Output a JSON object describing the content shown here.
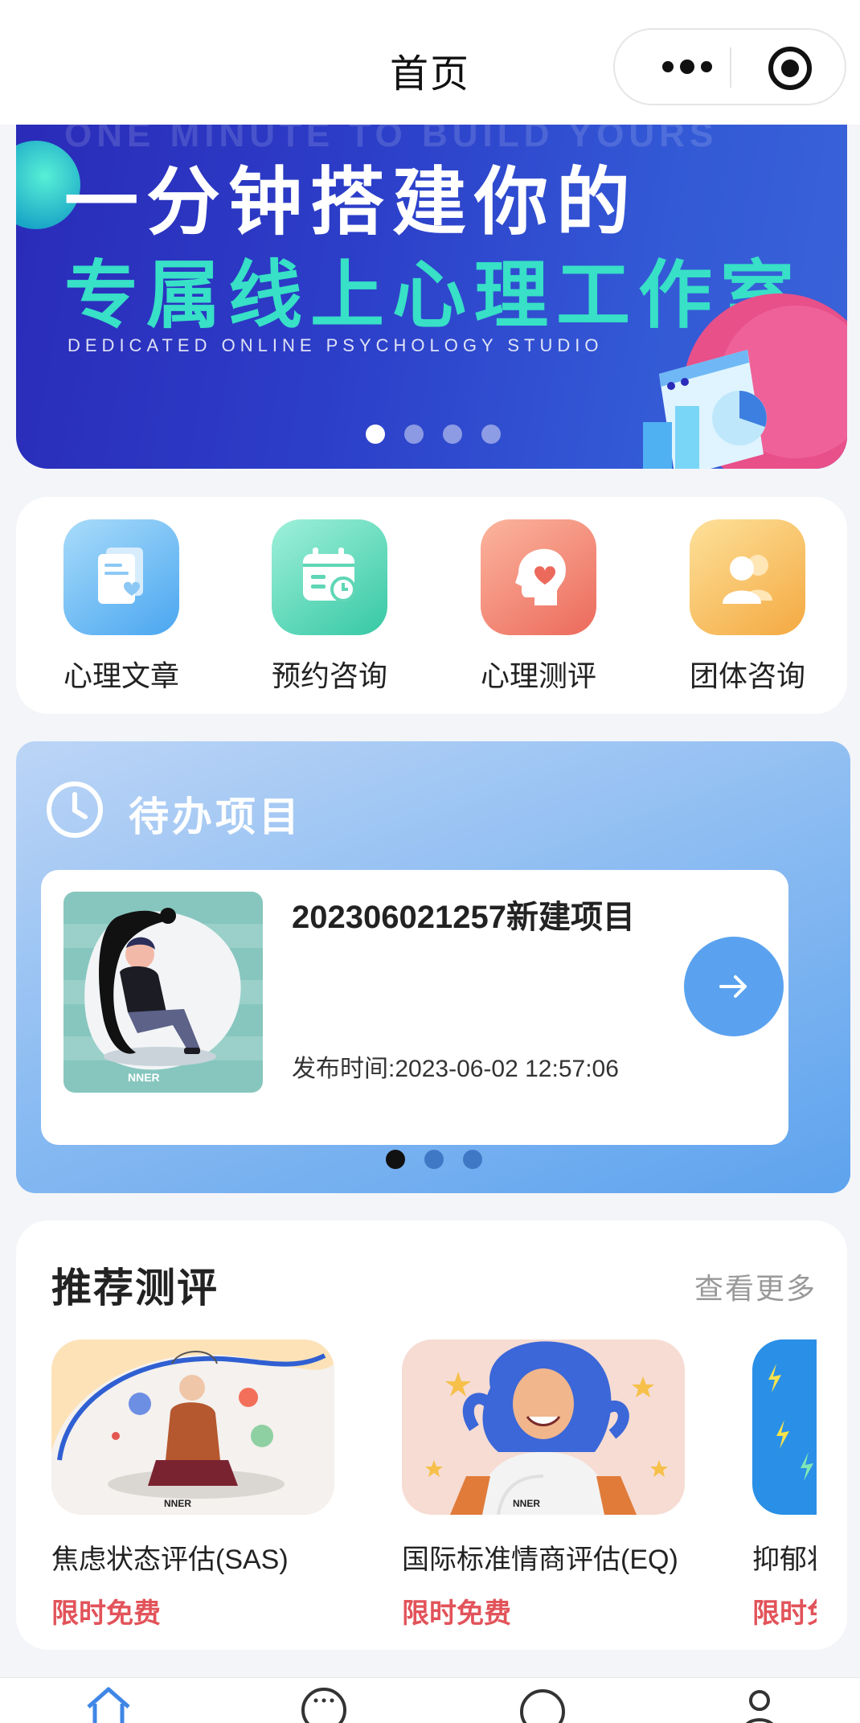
{
  "header": {
    "title": "首页"
  },
  "banner": {
    "eng_top": "ONE MINUTE TO BUILD YOURS",
    "line1": "一分钟搭建你的",
    "line2": "专属线上心理工作室",
    "eng_sub": "DEDICATED ONLINE PSYCHOLOGY STUDIO",
    "slide_count": 4,
    "active_slide": 1
  },
  "quick_nav": [
    {
      "label": "心理文章",
      "icon": "article-icon",
      "color_from": "#8fd0f7",
      "color_to": "#4aa6f0"
    },
    {
      "label": "预约咨询",
      "icon": "calendar-icon",
      "color_from": "#7ee3c9",
      "color_to": "#36c8a4"
    },
    {
      "label": "心理测评",
      "icon": "head-heart-icon",
      "color_from": "#f7a88f",
      "color_to": "#ee6f5e"
    },
    {
      "label": "团体咨询",
      "icon": "group-icon",
      "color_from": "#fbd07d",
      "color_to": "#f4a941"
    }
  ],
  "todo": {
    "title": "待办项目",
    "items": [
      {
        "name": "202306021257新建项目",
        "time": "发布时间:2023-06-02 12:57:06"
      }
    ],
    "page_count": 3,
    "active_page": 1
  },
  "recommend": {
    "title": "推荐测评",
    "more": "查看更多",
    "items": [
      {
        "name": "焦虑状态评估(SAS)",
        "badge": "限时免费"
      },
      {
        "name": "国际标准情商评估(EQ)",
        "badge": "限时免费"
      },
      {
        "name": "抑郁状",
        "badge": "限时免"
      }
    ]
  },
  "tabbar": {
    "items": [
      "home-icon",
      "chat-dots-icon",
      "message-icon",
      "user-icon"
    ]
  },
  "colors": {
    "accent_blue": "#5aa2ef",
    "badge_red": "#e2535a",
    "teal": "#37e0c6"
  }
}
